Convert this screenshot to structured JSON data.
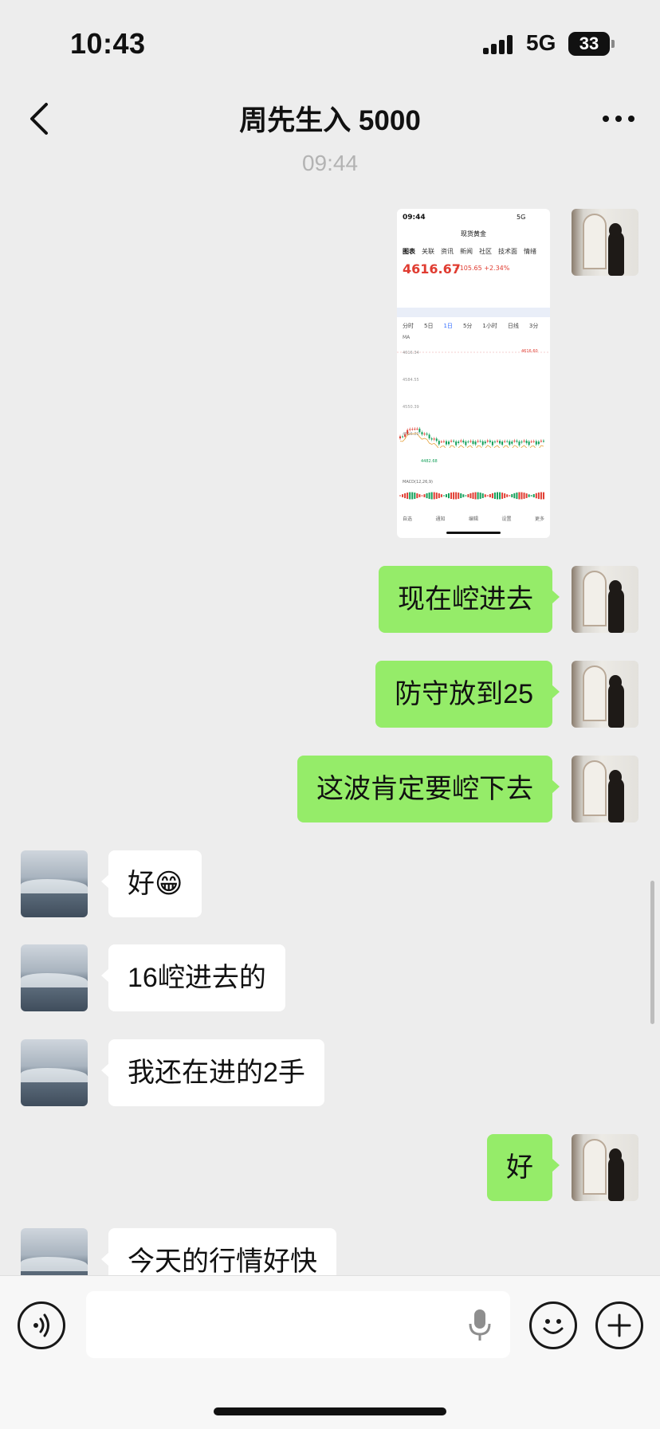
{
  "status": {
    "time": "10:43",
    "network": "5G",
    "battery": "33"
  },
  "nav": {
    "title": "周先生入 5000"
  },
  "chat": {
    "timestamp": "09:44",
    "messages": [
      {
        "sender": "self",
        "text": "现在崆进去"
      },
      {
        "sender": "self",
        "text": "防守放到25"
      },
      {
        "sender": "self",
        "text": "这波肯定要崆下去"
      },
      {
        "sender": "peer",
        "text": "好😁"
      },
      {
        "sender": "peer",
        "text": "16崆进去的"
      },
      {
        "sender": "peer",
        "text": "我还在进的2手"
      },
      {
        "sender": "self",
        "text": "好"
      },
      {
        "sender": "peer",
        "text": "今天的行情好快"
      }
    ]
  },
  "screenshot": {
    "time": "09:44",
    "app_title": "现货黄金",
    "tabs": [
      "图表",
      "关联",
      "资讯",
      "新闻",
      "社区",
      "技术面",
      "情绪"
    ],
    "price": "4616.67",
    "change": "+105.65 +2.34%",
    "periods": [
      "分时",
      "5日",
      "1日",
      "5分",
      "1小时",
      "日线",
      "3分"
    ],
    "high_label": "4616.60",
    "low_label": "4482.68",
    "y_ticks": [
      "4616.34",
      "4584.55",
      "4550.39",
      "4516.22"
    ],
    "ma_label": "MA",
    "macd_label": "MACD(12,26,9)",
    "bottom_tabs": [
      "自选",
      "通知",
      "编辑",
      "设置",
      "更多"
    ],
    "series_color": "#e03c31",
    "down_color": "#14a05a"
  },
  "input": {
    "placeholder": ""
  },
  "colors": {
    "self_bubble": "#95ec69",
    "peer_bubble": "#ffffff",
    "background": "#ededed"
  }
}
